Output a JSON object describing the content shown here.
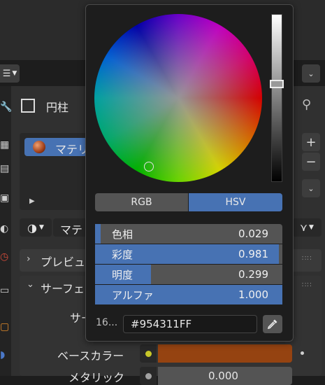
{
  "header": {
    "object_name": "円柱"
  },
  "material_slot": {
    "name": "マテリ"
  },
  "material_selector": {
    "name": "マテ"
  },
  "panels": {
    "preview": "プレビュ",
    "surface": "サーフェ",
    "surface_row": "サー",
    "base_color_label": "ベースカラー",
    "metallic_label": "メタリック",
    "metallic_value": "0.000"
  },
  "colors": {
    "accent": "#4772b3",
    "base_color": "#954311"
  },
  "color_picker": {
    "modes": [
      "RGB",
      "HSV"
    ],
    "active_mode": "HSV",
    "fields": [
      {
        "label": "色相",
        "value": "0.029",
        "level": 0.029
      },
      {
        "label": "彩度",
        "value": "0.981",
        "level": 0.981
      },
      {
        "label": "明度",
        "value": "0.299",
        "level": 0.299
      },
      {
        "label": "アルファ",
        "value": "1.000",
        "level": 1.0
      }
    ],
    "hex_label": "16...",
    "hex_value": "#954311FF"
  },
  "icons": [
    "editor-type-icon",
    "chevron-down-icon",
    "object-icon",
    "pin-icon",
    "material-sphere-icon",
    "plus-icon",
    "minus-icon",
    "triangle-right-icon",
    "shader-node-icon",
    "chevron-right-icon",
    "drag-handle-icon",
    "eyedropper-icon"
  ]
}
